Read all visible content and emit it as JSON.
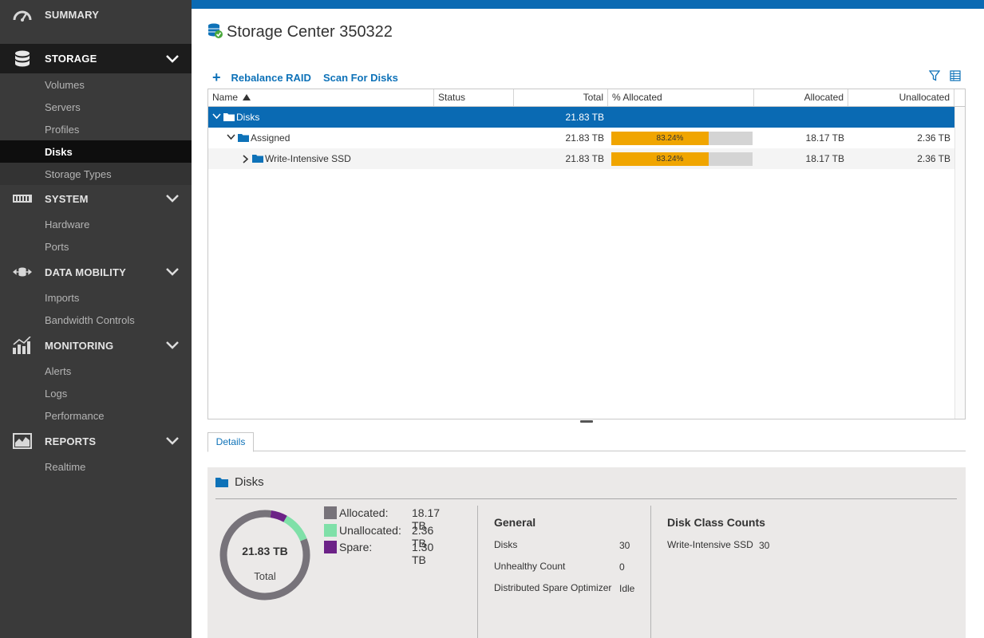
{
  "sidebar": {
    "summary": {
      "label": "SUMMARY",
      "icon": "dashboard-gauge-icon"
    },
    "storage": {
      "label": "STORAGE",
      "icon": "database-icon",
      "items": [
        "Volumes",
        "Servers",
        "Profiles",
        "Disks",
        "Storage Types"
      ],
      "active": "Disks"
    },
    "system": {
      "label": "SYSTEM",
      "icon": "hardware-rack-icon",
      "items": [
        "Hardware",
        "Ports"
      ]
    },
    "data_mobility": {
      "label": "DATA MOBILITY",
      "icon": "data-move-icon",
      "items": [
        "Imports",
        "Bandwidth Controls"
      ]
    },
    "monitoring": {
      "label": "MONITORING",
      "icon": "bar-chart-icon",
      "items": [
        "Alerts",
        "Logs",
        "Performance"
      ]
    },
    "reports": {
      "label": "REPORTS",
      "icon": "line-chart-icon",
      "items": [
        "Realtime"
      ]
    }
  },
  "header": {
    "title": "Storage Center 350322",
    "icon": "storage-center-check-icon"
  },
  "toolbar": {
    "add_icon": "plus-icon",
    "rebalance": "Rebalance RAID",
    "scan": "Scan For Disks",
    "filter_icon": "filter-icon",
    "columns_icon": "column-chooser-icon"
  },
  "grid": {
    "columns": [
      "Name",
      "Status",
      "Total",
      "% Allocated",
      "Allocated",
      "Unallocated"
    ],
    "sort_column": "Name",
    "sort_direction": "ascending",
    "rows": [
      {
        "name": "Disks",
        "level": 0,
        "expanded": true,
        "selected": true,
        "total": "21.83 TB",
        "pct": "",
        "allocated": "",
        "unallocated": ""
      },
      {
        "name": "Assigned",
        "level": 1,
        "expanded": true,
        "selected": false,
        "total": "21.83 TB",
        "pct": "83.24%",
        "pct_value": 0.8324,
        "allocated": "18.17 TB",
        "unallocated": "2.36 TB"
      },
      {
        "name": "Write-Intensive SSD",
        "level": 2,
        "expanded": false,
        "selected": false,
        "total": "21.83 TB",
        "pct": "83.24%",
        "pct_value": 0.8324,
        "allocated": "18.17 TB",
        "unallocated": "2.36 TB"
      }
    ]
  },
  "tabs": {
    "details": "Details"
  },
  "details": {
    "title": "Disks",
    "donut": {
      "total": "21.83 TB",
      "caption": "Total",
      "segments": [
        {
          "name": "Allocated",
          "value": 18.17,
          "color": "#77737a"
        },
        {
          "name": "Unallocated",
          "value": 2.36,
          "color": "#7fe0a8"
        },
        {
          "name": "Spare",
          "value": 1.3,
          "color": "#6c2287"
        }
      ]
    },
    "legend": [
      {
        "label": "Allocated:",
        "value": "18.17 TB",
        "color": "#77737a"
      },
      {
        "label": "Unallocated:",
        "value": "2.36 TB",
        "color": "#7fe0a8"
      },
      {
        "label": "Spare:",
        "value": "1.30 TB",
        "color": "#6c2287"
      }
    ],
    "general": {
      "heading": "General",
      "rows": [
        {
          "label": "Disks",
          "value": "30"
        },
        {
          "label": "Unhealthy Count",
          "value": "0"
        },
        {
          "label": "Distributed Spare Optimizer",
          "value": "Idle"
        }
      ]
    },
    "disk_class": {
      "heading": "Disk Class Counts",
      "rows": [
        {
          "label": "Write-Intensive SSD",
          "value": "30"
        }
      ]
    }
  },
  "colors": {
    "accent": "#0a6ab3",
    "link": "#0e72b8",
    "progress": "#f0a500",
    "sidebar": "#3a3a3a"
  }
}
